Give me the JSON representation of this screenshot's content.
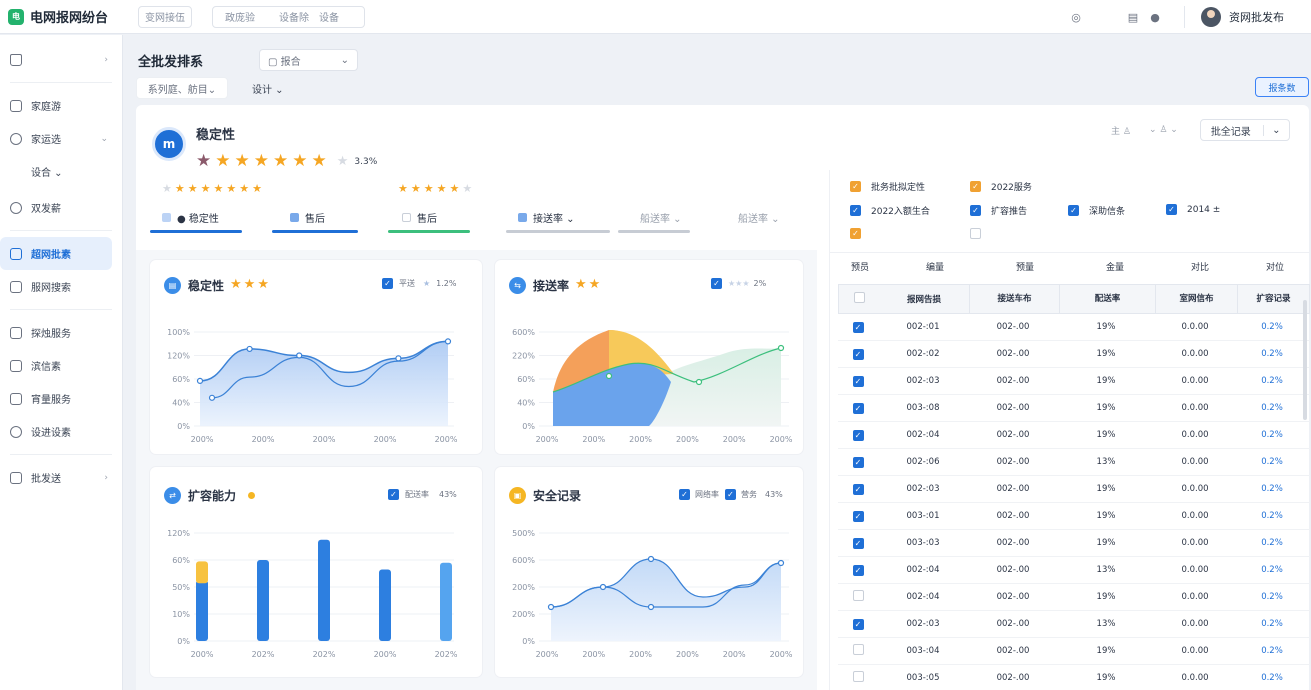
{
  "app": {
    "title": "电网报网纷台",
    "logo_mark": "电"
  },
  "header": {
    "box1": "变网接伍",
    "box2_items": [
      "政庞验",
      "设备除",
      "设备"
    ],
    "user_name": "资网批发布"
  },
  "sidebar": {
    "items": [
      {
        "label": "",
        "icon": "home-icon",
        "arrow": "›"
      },
      {
        "label": "家庭游",
        "icon": "doc-icon"
      },
      {
        "label": "家运选",
        "icon": "clock-icon",
        "arrow": "⌄"
      },
      {
        "label": "设合 ⌄",
        "icon": ""
      },
      {
        "label": "双发薪",
        "icon": "circle-icon"
      },
      {
        "label": "超网批素",
        "icon": "grid-icon",
        "active": true
      },
      {
        "label": "服网搜索",
        "icon": "calendar-icon"
      },
      {
        "label": "探烛服务",
        "icon": "check-icon"
      },
      {
        "label": "滨信素",
        "icon": "list-icon"
      },
      {
        "label": "宵量服务",
        "icon": "file-icon"
      },
      {
        "label": "设进设素",
        "icon": "play-icon"
      },
      {
        "label": "批发送",
        "icon": "folder-icon",
        "arrow": "›"
      }
    ]
  },
  "page": {
    "title": "全批发排系",
    "title_select": "报合",
    "subtab1": "系列庭、舫目⌄",
    "subtab2": "设计 ⌄",
    "primary_button": "报条数"
  },
  "summary": {
    "title": "稳定性",
    "rating_text": "3.3%",
    "right_controls": [
      "主 ♙",
      "⌄ ♙ ⌄"
    ],
    "right_select": "批全记录"
  },
  "tabs": [
    {
      "label": "● 稳定性",
      "color": "#1f6fd6"
    },
    {
      "label": "售后",
      "color": "#1f6fd6"
    },
    {
      "label": "售后",
      "color": "#3cbf7d"
    },
    {
      "label": "接送率 ⌄",
      "color": "#c7ccd4"
    },
    {
      "label": "船送率 ⌄",
      "color": "#c7ccd4"
    },
    {
      "label": "船送率 ⌄",
      "color": "#c7ccd4"
    }
  ],
  "cards": {
    "c1": {
      "title": "稳定性",
      "legend1": "平送",
      "legend2": "1.2%"
    },
    "c2": {
      "title": "接送率",
      "legend2": "2%"
    },
    "c3": {
      "title": "扩容能力",
      "legend1": "配送率",
      "legend2": "43%"
    },
    "c4": {
      "title": "安全记录",
      "legend1": "网络率",
      "legend2": "营务",
      "legend3": "43%"
    }
  },
  "chart_data": [
    {
      "type": "area",
      "title": "稳定性",
      "y_ticks": [
        "100%",
        "120%",
        "60%",
        "40%",
        "0%"
      ],
      "x_ticks": [
        "200%",
        "200%",
        "200%",
        "200%",
        "200%"
      ],
      "series": [
        {
          "values": [
            48,
            82,
            75,
            57,
            72,
            90
          ]
        },
        {
          "values": [
            30,
            52,
            73,
            42,
            69,
            90
          ]
        }
      ]
    },
    {
      "type": "area",
      "title": "接送率",
      "y_ticks": [
        "600%",
        "220%",
        "60%",
        "40%",
        "0%"
      ],
      "x_ticks": [
        "200%",
        "200%",
        "200%",
        "200%",
        "200%",
        "200%"
      ]
    },
    {
      "type": "bar",
      "title": "扩容能力",
      "y_ticks": [
        "120%",
        "60%",
        "50%",
        "10%",
        "0%"
      ],
      "x_ticks": [
        "200%",
        "202%",
        "202%",
        "200%",
        "202%"
      ],
      "values": [
        45,
        60,
        75,
        53,
        58
      ],
      "stack_top": [
        14,
        0,
        0,
        0,
        0
      ]
    },
    {
      "type": "area",
      "title": "安全记录",
      "y_ticks": [
        "500%",
        "600%",
        "200%",
        "200%",
        "0%"
      ],
      "x_ticks": [
        "200%",
        "200%",
        "200%",
        "200%",
        "200%",
        "200%"
      ]
    }
  ],
  "filters": [
    {
      "label": "批务批拟定性",
      "style": "orange"
    },
    {
      "label": "2022服务",
      "style": "orange"
    },
    {
      "label": "2022入额生合",
      "style": "blue"
    },
    {
      "label": "扩容推告",
      "style": "blue"
    },
    {
      "label": "深助信条",
      "style": "blue"
    },
    {
      "label": "2014 ±",
      "style": "blue"
    }
  ],
  "table": {
    "top_headers": [
      "预员",
      "编量",
      "预量",
      "金量",
      "对比",
      "对位"
    ],
    "headers": [
      "报网告损",
      "接送车布",
      "配送率",
      "室网信布",
      "扩容记录"
    ],
    "rows": [
      {
        "checked": true,
        "code": "002-:01",
        "v": "002-.00",
        "p": "19%",
        "n": "0.0.00",
        "r": "0.2%"
      },
      {
        "checked": true,
        "code": "002-:02",
        "v": "002-.00",
        "p": "19%",
        "n": "0.0.00",
        "r": "0.2%"
      },
      {
        "checked": true,
        "code": "002-:03",
        "v": "002-.00",
        "p": "19%",
        "n": "0.0.00",
        "r": "0.2%"
      },
      {
        "checked": true,
        "code": "003-:08",
        "v": "002-.00",
        "p": "19%",
        "n": "0.0.00",
        "r": "0.2%"
      },
      {
        "checked": true,
        "code": "002-:04",
        "v": "002-.00",
        "p": "19%",
        "n": "0.0.00",
        "r": "0.2%"
      },
      {
        "checked": true,
        "code": "002-:06",
        "v": "002-.00",
        "p": "13%",
        "n": "0.0.00",
        "r": "0.2%"
      },
      {
        "checked": true,
        "code": "002-:03",
        "v": "002-.00",
        "p": "19%",
        "n": "0.0.00",
        "r": "0.2%"
      },
      {
        "checked": true,
        "code": "003-:01",
        "v": "002-.00",
        "p": "19%",
        "n": "0.0.00",
        "r": "0.2%"
      },
      {
        "checked": true,
        "code": "003-:03",
        "v": "002-.00",
        "p": "19%",
        "n": "0.0.00",
        "r": "0.2%"
      },
      {
        "checked": true,
        "code": "002-:04",
        "v": "002-.00",
        "p": "13%",
        "n": "0.0.00",
        "r": "0.2%"
      },
      {
        "checked": false,
        "code": "002-:04",
        "v": "002-.00",
        "p": "19%",
        "n": "0.0.00",
        "r": "0.2%"
      },
      {
        "checked": true,
        "code": "002-:03",
        "v": "002-.00",
        "p": "13%",
        "n": "0.0.00",
        "r": "0.2%"
      },
      {
        "checked": false,
        "code": "003-:04",
        "v": "002-.00",
        "p": "19%",
        "n": "0.0.00",
        "r": "0.2%"
      },
      {
        "checked": false,
        "code": "003-:05",
        "v": "002-.00",
        "p": "19%",
        "n": "0.0.00",
        "r": "0.2%"
      }
    ]
  },
  "colors": {
    "primary": "#1f6fd6",
    "accent": "#f5a623",
    "green": "#3cbf7d"
  }
}
